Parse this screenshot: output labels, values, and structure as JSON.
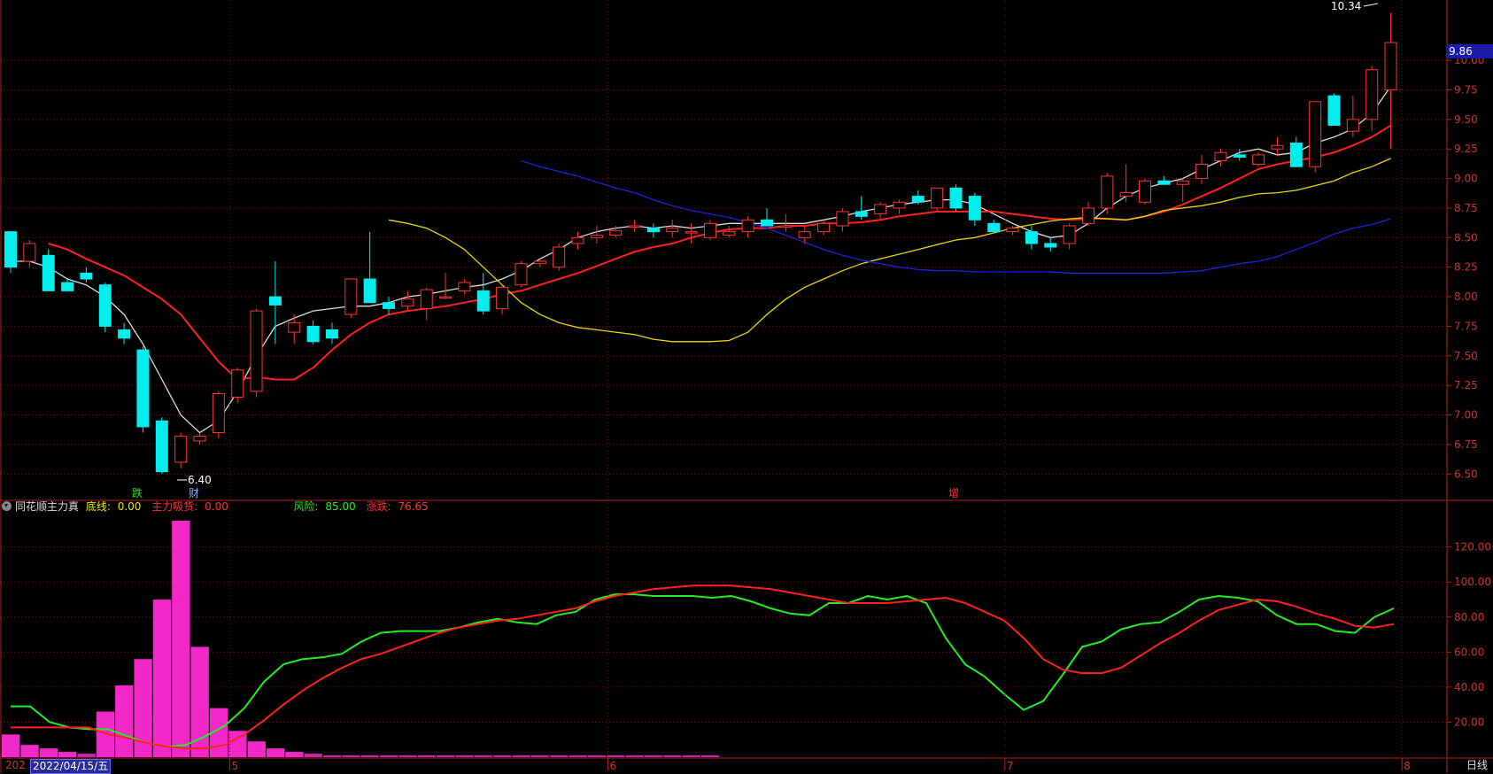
{
  "price_tag": "9.86",
  "high_label": "10.34",
  "low_label": "6.40",
  "markers": [
    {
      "label": "跌",
      "color": "#22dd22"
    },
    {
      "label": "财",
      "color": "#88aaff"
    },
    {
      "label": "增",
      "color": "#ff3333"
    }
  ],
  "indicator": {
    "name": "同花顺主力真",
    "base_label": "底线:",
    "base_value": "0.00",
    "absorb_label": "主力吸货:",
    "absorb_value": "0.00",
    "risk_label": "风险:",
    "risk_value": "85.00",
    "change_label": "涨跌:",
    "change_value": "76.65",
    "colors": {
      "base": "#e8e800",
      "absorb": "#ff3333",
      "risk": "#22ee22",
      "change": "#ff3333"
    }
  },
  "bottom_bar": {
    "date_prefix": "202",
    "date": "2022/04/15/五",
    "period": "日线"
  },
  "colors": {
    "up": "#ff3333",
    "down": "#00eeee",
    "ma5": "#dddddd",
    "ma10": "#ff2020",
    "ma20": "#e8d800",
    "ma60": "#2020dd",
    "risk": "#22ee22",
    "change": "#ff2020",
    "bars": "#ff2ad4",
    "grid": "#6a1010"
  },
  "chart_data": [
    {
      "type": "candlestick",
      "ylim": [
        6.3,
        10.45
      ],
      "yticks": [
        "6.50",
        "6.75",
        "7.00",
        "7.25",
        "7.50",
        "7.75",
        "8.00",
        "8.25",
        "8.50",
        "8.75",
        "9.00",
        "9.25",
        "9.50",
        "9.75",
        "10.00"
      ],
      "ytick_values": [
        6.5,
        6.75,
        7.0,
        7.25,
        7.5,
        7.75,
        8.0,
        8.25,
        8.5,
        8.75,
        9.0,
        9.25,
        9.5,
        9.75,
        10.0
      ],
      "x_month_labels": [
        {
          "label": "5",
          "index": 12
        },
        {
          "label": "6",
          "index": 32
        },
        {
          "label": "7",
          "index": 53
        },
        {
          "label": "8",
          "index": 74
        }
      ],
      "ohlc": [
        [
          8.55,
          8.52,
          8.2,
          8.25
        ],
        [
          8.3,
          8.48,
          8.25,
          8.45
        ],
        [
          8.35,
          8.4,
          8.05,
          8.05
        ],
        [
          8.12,
          8.15,
          8.05,
          8.05
        ],
        [
          8.2,
          8.25,
          8.12,
          8.15
        ],
        [
          8.1,
          8.12,
          7.7,
          7.75
        ],
        [
          7.72,
          7.78,
          7.6,
          7.65
        ],
        [
          7.55,
          7.58,
          6.85,
          6.9
        ],
        [
          6.95,
          6.98,
          6.5,
          6.52
        ],
        [
          6.6,
          6.85,
          6.55,
          6.82
        ],
        [
          6.78,
          6.85,
          6.75,
          6.82
        ],
        [
          6.85,
          7.2,
          6.8,
          7.18
        ],
        [
          7.15,
          7.4,
          7.1,
          7.38
        ],
        [
          7.2,
          7.9,
          7.15,
          7.88
        ],
        [
          8.0,
          8.3,
          7.6,
          7.93
        ],
        [
          7.7,
          7.85,
          7.6,
          7.78
        ],
        [
          7.75,
          7.8,
          7.6,
          7.62
        ],
        [
          7.72,
          7.78,
          7.6,
          7.65
        ],
        [
          7.85,
          8.15,
          7.82,
          8.15
        ],
        [
          8.15,
          8.55,
          7.95,
          7.95
        ],
        [
          7.95,
          8.0,
          7.85,
          7.9
        ],
        [
          7.92,
          8.05,
          7.88,
          7.98
        ],
        [
          7.9,
          8.08,
          7.8,
          8.06
        ],
        [
          8.0,
          8.2,
          7.98,
          8.0
        ],
        [
          8.05,
          8.15,
          8.02,
          8.12
        ],
        [
          8.05,
          8.2,
          7.85,
          7.88
        ],
        [
          7.9,
          8.1,
          7.85,
          8.08
        ],
        [
          8.1,
          8.3,
          8.08,
          8.28
        ],
        [
          8.28,
          8.32,
          8.25,
          8.3
        ],
        [
          8.25,
          8.45,
          8.22,
          8.42
        ],
        [
          8.45,
          8.55,
          8.4,
          8.5
        ],
        [
          8.5,
          8.6,
          8.45,
          8.52
        ],
        [
          8.52,
          8.6,
          8.5,
          8.56
        ],
        [
          8.6,
          8.65,
          8.55,
          8.6
        ],
        [
          8.58,
          8.62,
          8.5,
          8.55
        ],
        [
          8.55,
          8.65,
          8.5,
          8.58
        ],
        [
          8.55,
          8.62,
          8.45,
          8.55
        ],
        [
          8.5,
          8.65,
          8.48,
          8.62
        ],
        [
          8.52,
          8.6,
          8.5,
          8.55
        ],
        [
          8.55,
          8.68,
          8.5,
          8.65
        ],
        [
          8.65,
          8.75,
          8.6,
          8.6
        ],
        [
          8.6,
          8.7,
          8.55,
          8.6
        ],
        [
          8.5,
          8.6,
          8.45,
          8.55
        ],
        [
          8.55,
          8.65,
          8.52,
          8.62
        ],
        [
          8.6,
          8.75,
          8.55,
          8.72
        ],
        [
          8.72,
          8.85,
          8.65,
          8.68
        ],
        [
          8.7,
          8.8,
          8.65,
          8.78
        ],
        [
          8.75,
          8.82,
          8.7,
          8.8
        ],
        [
          8.85,
          8.9,
          8.78,
          8.8
        ],
        [
          8.75,
          8.92,
          8.72,
          8.92
        ],
        [
          8.92,
          8.95,
          8.72,
          8.75
        ],
        [
          8.85,
          8.88,
          8.6,
          8.65
        ],
        [
          8.62,
          8.65,
          8.55,
          8.55
        ],
        [
          8.55,
          8.6,
          8.52,
          8.58
        ],
        [
          8.55,
          8.6,
          8.4,
          8.45
        ],
        [
          8.45,
          8.5,
          8.38,
          8.42
        ],
        [
          8.45,
          8.62,
          8.4,
          8.6
        ],
        [
          8.62,
          8.8,
          8.6,
          8.75
        ],
        [
          8.75,
          9.05,
          8.7,
          9.02
        ],
        [
          8.85,
          9.12,
          8.8,
          8.88
        ],
        [
          8.8,
          9.0,
          8.78,
          8.98
        ],
        [
          8.98,
          9.02,
          8.95,
          8.95
        ],
        [
          8.95,
          9.0,
          8.8,
          8.98
        ],
        [
          9.0,
          9.2,
          8.95,
          9.12
        ],
        [
          9.15,
          9.25,
          9.1,
          9.22
        ],
        [
          9.2,
          9.25,
          9.15,
          9.18
        ],
        [
          9.12,
          9.22,
          9.1,
          9.2
        ],
        [
          9.25,
          9.35,
          9.2,
          9.28
        ],
        [
          9.3,
          9.35,
          9.1,
          9.1
        ],
        [
          9.1,
          9.55,
          9.05,
          9.65
        ],
        [
          9.7,
          9.72,
          9.45,
          9.45
        ],
        [
          9.4,
          9.7,
          9.35,
          9.5
        ],
        [
          9.5,
          9.95,
          9.4,
          9.92
        ],
        [
          9.75,
          10.4,
          9.25,
          10.15
        ]
      ]
    },
    {
      "type": "line",
      "series": [
        {
          "name": "MA5",
          "color": "#dddddd",
          "values": [
            8.3,
            8.3,
            8.25,
            8.15,
            8.1,
            8.0,
            7.85,
            7.6,
            7.3,
            7.0,
            6.85,
            6.95,
            7.2,
            7.5,
            7.75,
            7.82,
            7.88,
            7.9,
            7.92,
            7.92,
            7.95,
            8.0,
            8.02,
            8.05,
            8.08,
            8.1,
            8.15,
            8.22,
            8.32,
            8.4,
            8.5,
            8.55,
            8.58,
            8.6,
            8.58,
            8.6,
            8.58,
            8.6,
            8.62,
            8.62,
            8.62,
            8.62,
            8.62,
            8.65,
            8.68,
            8.72,
            8.75,
            8.78,
            8.8,
            8.82,
            8.82,
            8.78,
            8.7,
            8.62,
            8.55,
            8.5,
            8.52,
            8.62,
            8.75,
            8.85,
            8.92,
            8.96,
            9.0,
            9.08,
            9.15,
            9.22,
            9.25,
            9.2,
            9.22,
            9.3,
            9.35,
            9.42,
            9.55,
            9.78
          ]
        },
        {
          "name": "MA10",
          "color": "#ff2020",
          "values": [
            8.45,
            8.4,
            8.32,
            8.25,
            8.18,
            8.08,
            7.98,
            7.85,
            7.65,
            7.45,
            7.3,
            7.32,
            7.3,
            7.3,
            7.4,
            7.55,
            7.68,
            7.78,
            7.85,
            7.88,
            7.9,
            7.92,
            7.95,
            7.98,
            8.02,
            8.05,
            8.1,
            8.15,
            8.2,
            8.26,
            8.32,
            8.38,
            8.42,
            8.45,
            8.5,
            8.54,
            8.57,
            8.58,
            8.58,
            8.6,
            8.6,
            8.62,
            8.62,
            8.63,
            8.65,
            8.68,
            8.7,
            8.72,
            8.72,
            8.72,
            8.72,
            8.7,
            8.68,
            8.66,
            8.65,
            8.66,
            8.66,
            8.65,
            8.68,
            8.72,
            8.78,
            8.85,
            8.92,
            9.0,
            9.08,
            9.12,
            9.15,
            9.18,
            9.22,
            9.28,
            9.35,
            9.45
          ]
        },
        {
          "name": "MA20",
          "color": "#e8d800",
          "values": [
            8.65,
            8.62,
            8.58,
            8.5,
            8.4,
            8.25,
            8.1,
            7.95,
            7.85,
            7.78,
            7.74,
            7.72,
            7.7,
            7.68,
            7.64,
            7.62,
            7.62,
            7.62,
            7.63,
            7.7,
            7.85,
            7.98,
            8.08,
            8.15,
            8.22,
            8.28,
            8.32,
            8.36,
            8.4,
            8.44,
            8.48,
            8.5,
            8.54,
            8.58,
            8.61,
            8.64,
            8.66,
            8.67,
            8.66,
            8.65,
            8.68,
            8.73,
            8.75,
            8.77,
            8.8,
            8.84,
            8.87,
            8.88,
            8.9,
            8.94,
            8.98,
            9.05,
            9.1,
            9.17
          ]
        },
        {
          "name": "MA60",
          "color": "#2020dd",
          "values": [
            9.15,
            9.1,
            9.06,
            9.02,
            8.97,
            8.92,
            8.88,
            8.82,
            8.77,
            8.73,
            8.7,
            8.67,
            8.63,
            8.58,
            8.52,
            8.46,
            8.4,
            8.35,
            8.31,
            8.28,
            8.25,
            8.23,
            8.22,
            8.22,
            8.21,
            8.21,
            8.21,
            8.21,
            8.21,
            8.2,
            8.2,
            8.2,
            8.2,
            8.2,
            8.2,
            8.21,
            8.22,
            8.25,
            8.28,
            8.3,
            8.34,
            8.4,
            8.46,
            8.53,
            8.58,
            8.61,
            8.66
          ]
        }
      ]
    },
    {
      "type": "bar_line",
      "ylim": [
        0,
        135
      ],
      "yticks": [
        "20.00",
        "40.00",
        "60.00",
        "80.00",
        "100.00",
        "120.00"
      ],
      "ytick_values": [
        20,
        40,
        60,
        80,
        100,
        120
      ],
      "bars": [
        13,
        7,
        5,
        3,
        2,
        26,
        41,
        56,
        90,
        135,
        63,
        28,
        15,
        9,
        5,
        3,
        2,
        1,
        1,
        1,
        1,
        1,
        1,
        1,
        1,
        1,
        1,
        1,
        1,
        1,
        1,
        1,
        1,
        1,
        1,
        1,
        1,
        1
      ],
      "series": [
        {
          "name": "风险",
          "color": "#22ee22",
          "values": [
            29,
            29,
            20,
            17,
            16,
            16,
            12,
            8,
            6,
            7,
            12,
            18,
            28,
            43,
            53,
            56,
            57,
            59,
            66,
            71,
            72,
            72,
            72,
            74,
            77,
            79,
            77,
            76,
            81,
            83,
            90,
            93,
            93,
            92,
            92,
            92,
            91,
            92,
            89,
            85,
            82,
            81,
            88,
            88,
            92,
            90,
            92,
            88,
            68,
            53,
            46,
            36,
            27,
            32,
            47,
            63,
            66,
            73,
            76,
            77,
            83,
            90,
            92,
            91,
            89,
            81,
            76,
            76,
            72,
            71,
            80,
            85
          ]
        },
        {
          "name": "涨跌",
          "color": "#ff2020",
          "values": [
            17,
            17,
            17,
            17,
            17,
            13,
            11,
            8,
            6,
            5,
            5,
            7,
            13,
            21,
            30,
            38,
            45,
            51,
            56,
            59,
            63,
            67,
            71,
            74,
            76,
            78,
            79,
            81,
            83,
            85,
            89,
            92,
            94,
            96,
            97,
            98,
            98,
            98,
            97,
            96,
            94,
            92,
            90,
            88,
            88,
            88,
            89,
            90,
            91,
            88,
            83,
            78,
            68,
            56,
            50,
            48,
            48,
            51,
            58,
            65,
            71,
            78,
            84,
            87,
            90,
            89,
            86,
            82,
            79,
            75,
            74,
            76
          ]
        }
      ]
    }
  ]
}
